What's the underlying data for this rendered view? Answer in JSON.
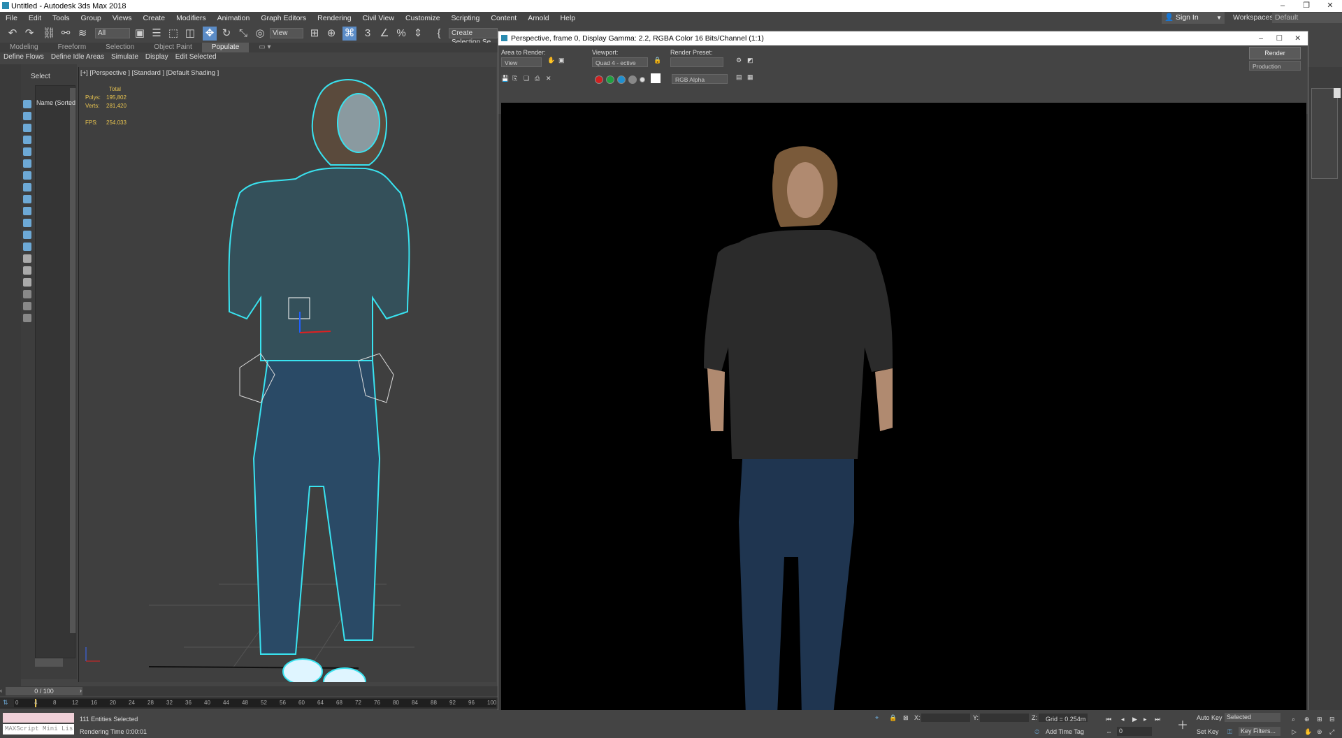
{
  "app": {
    "title": "Untitled - Autodesk 3ds Max 2018"
  },
  "menu": [
    "File",
    "Edit",
    "Tools",
    "Group",
    "Views",
    "Create",
    "Modifiers",
    "Animation",
    "Graph Editors",
    "Rendering",
    "Civil View",
    "Customize",
    "Scripting",
    "Content",
    "Arnold",
    "Help"
  ],
  "account": {
    "signin": "Sign In",
    "workspaces_label": "Workspaces:",
    "workspace": "Default"
  },
  "toolbar": {
    "filter": "All",
    "refcoord": "View",
    "selset": "Create Selection Se"
  },
  "ribbon": {
    "tabs": [
      "Modeling",
      "Freeform",
      "Selection",
      "Object Paint",
      "Populate"
    ],
    "active": "Populate",
    "tools": [
      "Define Flows",
      "Define Idle Areas",
      "Simulate",
      "Display",
      "Edit Selected"
    ]
  },
  "scene_explorer": {
    "select": "Select",
    "name_header": "Name (Sorted"
  },
  "viewport": {
    "label": "[+] [Perspective ] [Standard ] [Default Shading ]",
    "stats": {
      "total": "Total",
      "polys_label": "Polys:",
      "polys": "195,802",
      "verts_label": "Verts:",
      "verts": "281,420",
      "fps_label": "FPS:",
      "fps": "254.033"
    }
  },
  "frame_window": {
    "title": "Perspective, frame 0, Display Gamma: 2.2, RGBA Color 16 Bits/Channel (1:1)",
    "area_label": "Area to Render:",
    "area_value": "View",
    "viewport_label": "Viewport:",
    "viewport_value": "Quad 4 - ective",
    "preset_label": "Render Preset:",
    "preset_value": "",
    "render_button": "Render",
    "mode_value": "Production",
    "channel_value": "RGB Alpha"
  },
  "timeline": {
    "frame": "0 / 100",
    "ticks": [
      "0",
      "4",
      "8",
      "12",
      "16",
      "20",
      "24",
      "28",
      "32",
      "36",
      "40",
      "44",
      "48",
      "52",
      "56",
      "60",
      "64",
      "68",
      "72",
      "76",
      "80",
      "84",
      "88",
      "92",
      "96",
      "100"
    ]
  },
  "status": {
    "maxscript": "MAXScript Mini Lis",
    "selected": "111 Entities Selected",
    "render_time": "Rendering Time  0:00:01",
    "x_label": "X:",
    "y_label": "Y:",
    "z_label": "Z:",
    "grid": "Grid = 0.254m",
    "add_time_tag": "Add Time Tag",
    "auto_key": "Auto Key",
    "auto_key_value": "Selected",
    "set_key": "Set Key",
    "key_filters": "Key Filters...",
    "frame_field": "0"
  },
  "colors": {
    "accent": "#5b8cc7",
    "selection_outline": "#39e3f0",
    "stats_yellow": "#e8c450"
  }
}
